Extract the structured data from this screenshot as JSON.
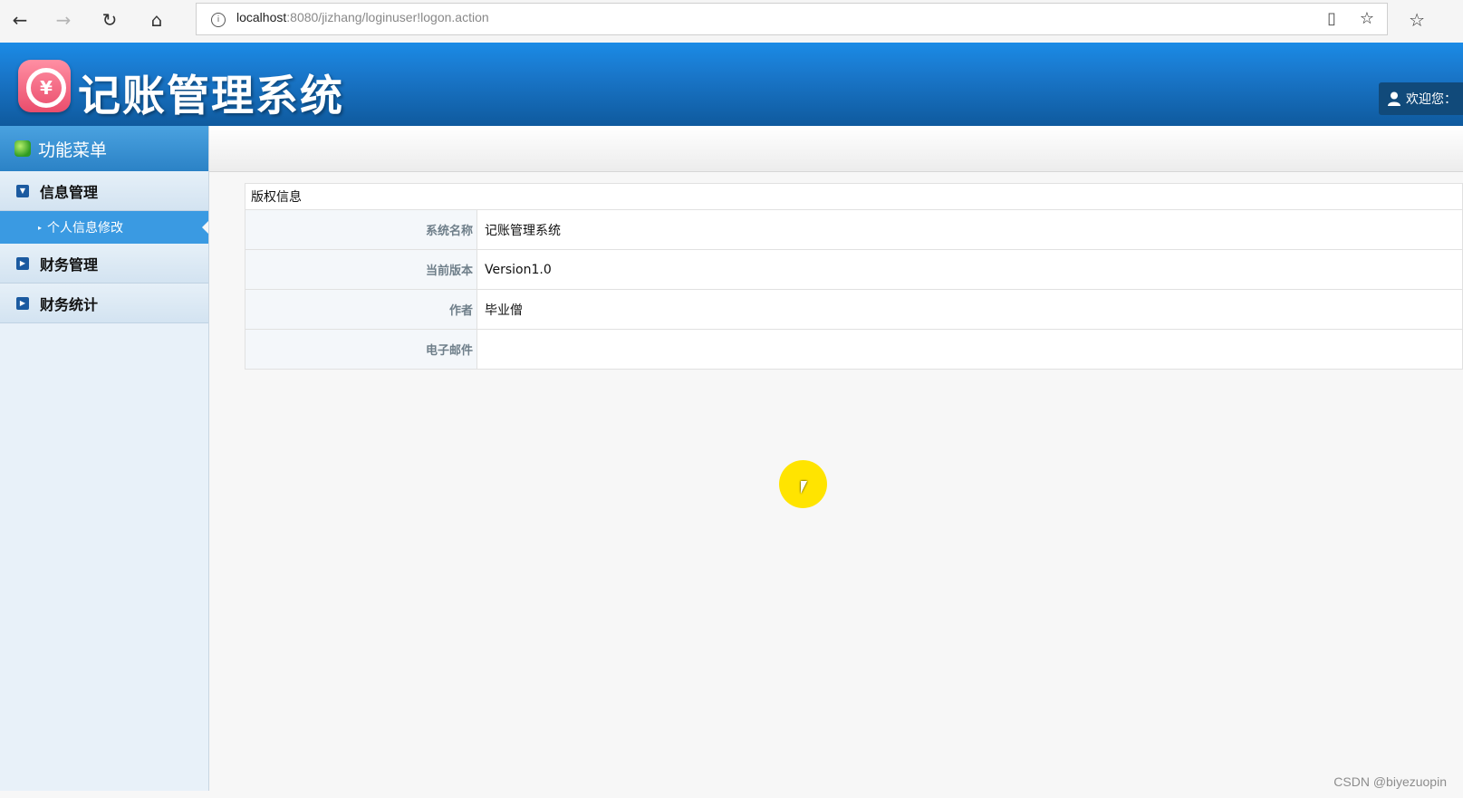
{
  "browser": {
    "url_host": "localhost",
    "url_rest": ":8080/jizhang/loginuser!logon.action",
    "info_icon": "info-icon",
    "back_icon": "←",
    "forward_icon": "→",
    "refresh_icon": "↻",
    "home_icon": "⌂",
    "reader_icon": "▯",
    "star_icon": "☆",
    "favorites_icon": "☆"
  },
  "header": {
    "app_title": "记账管理系统",
    "logo_symbol": "¥",
    "welcome_text": "欢迎您：",
    "user_icon": "user-icon"
  },
  "sidebar": {
    "title": "功能菜单",
    "groups": [
      {
        "label": "信息管理",
        "icon": "▼",
        "expanded": true
      },
      {
        "label": "财务管理",
        "icon": "▶",
        "expanded": false
      },
      {
        "label": "财务统计",
        "icon": "▶",
        "expanded": false
      }
    ],
    "active_sub_item": "个人信息修改"
  },
  "content": {
    "section_title": "版权信息",
    "rows": [
      {
        "label": "系统名称",
        "value": "记账管理系统"
      },
      {
        "label": "当前版本",
        "value": "Version1.0"
      },
      {
        "label": "作者",
        "value": "毕业僧"
      },
      {
        "label": "电子邮件",
        "value": ""
      }
    ]
  },
  "watermark": "CSDN @biyezuopin"
}
